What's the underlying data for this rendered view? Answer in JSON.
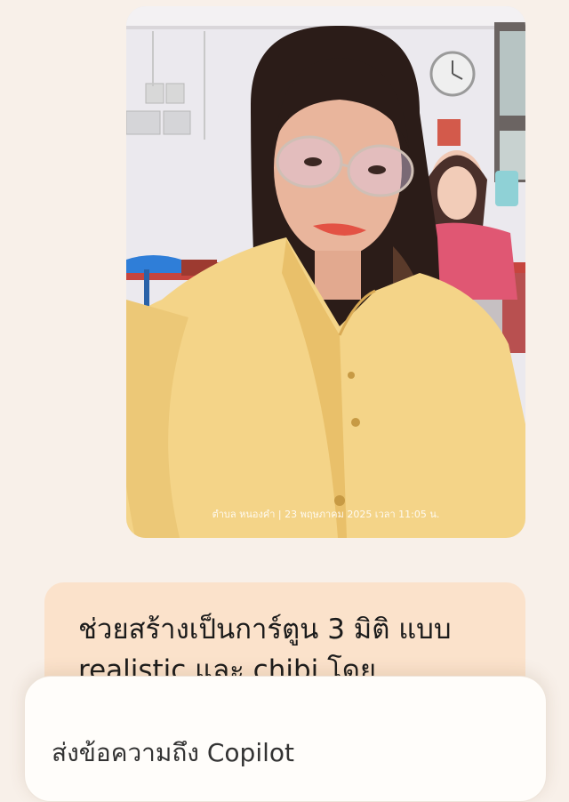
{
  "photo": {
    "description_alt": "",
    "timestamp": "ตำบล หนองคำ | 23 พฤษภาคม 2025 เวลา 11:05 น."
  },
  "message": {
    "text": "ช่วยสร้างเป็นการ์ตูน 3 มิติ แบบ realistic และ chibi โดย"
  },
  "composer": {
    "placeholder": "ส่งข้อความถึง Copilot"
  },
  "colors": {
    "background": "#f8f0e9",
    "bubble": "#fbe2cb",
    "composer": "#fffdfa"
  }
}
